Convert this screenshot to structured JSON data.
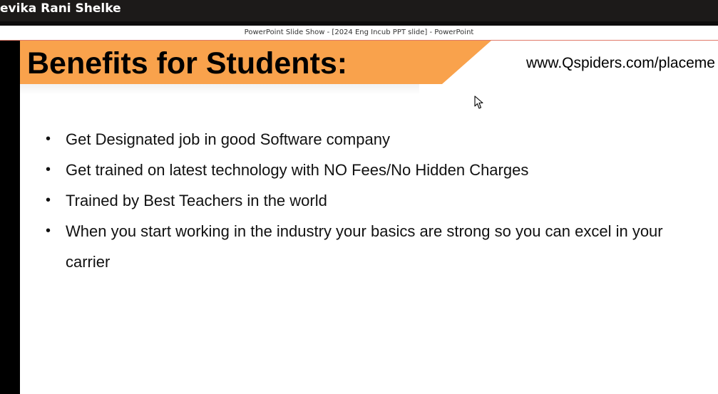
{
  "presenter": {
    "name": "evika Rani Shelke"
  },
  "window": {
    "title": "PowerPoint Slide Show - [2024 Eng Incub PPT slide] - PowerPoint"
  },
  "slide": {
    "title": "Benefits for Students:",
    "website": "www.Qspiders.com/placeme",
    "banner_color": "#f9a24c",
    "bullets": [
      {
        "text": "Get Designated job in good Software company"
      },
      {
        "text": "Get trained on latest technology with NO Fees/No Hidden Charges"
      },
      {
        "text": "Trained by Best Teachers in the world"
      },
      {
        "text": "When you start working in the industry your basics are strong so you can excel in your carrier"
      }
    ]
  },
  "icons": {
    "cursor": "mouse-pointer-icon",
    "bullet": "•"
  }
}
